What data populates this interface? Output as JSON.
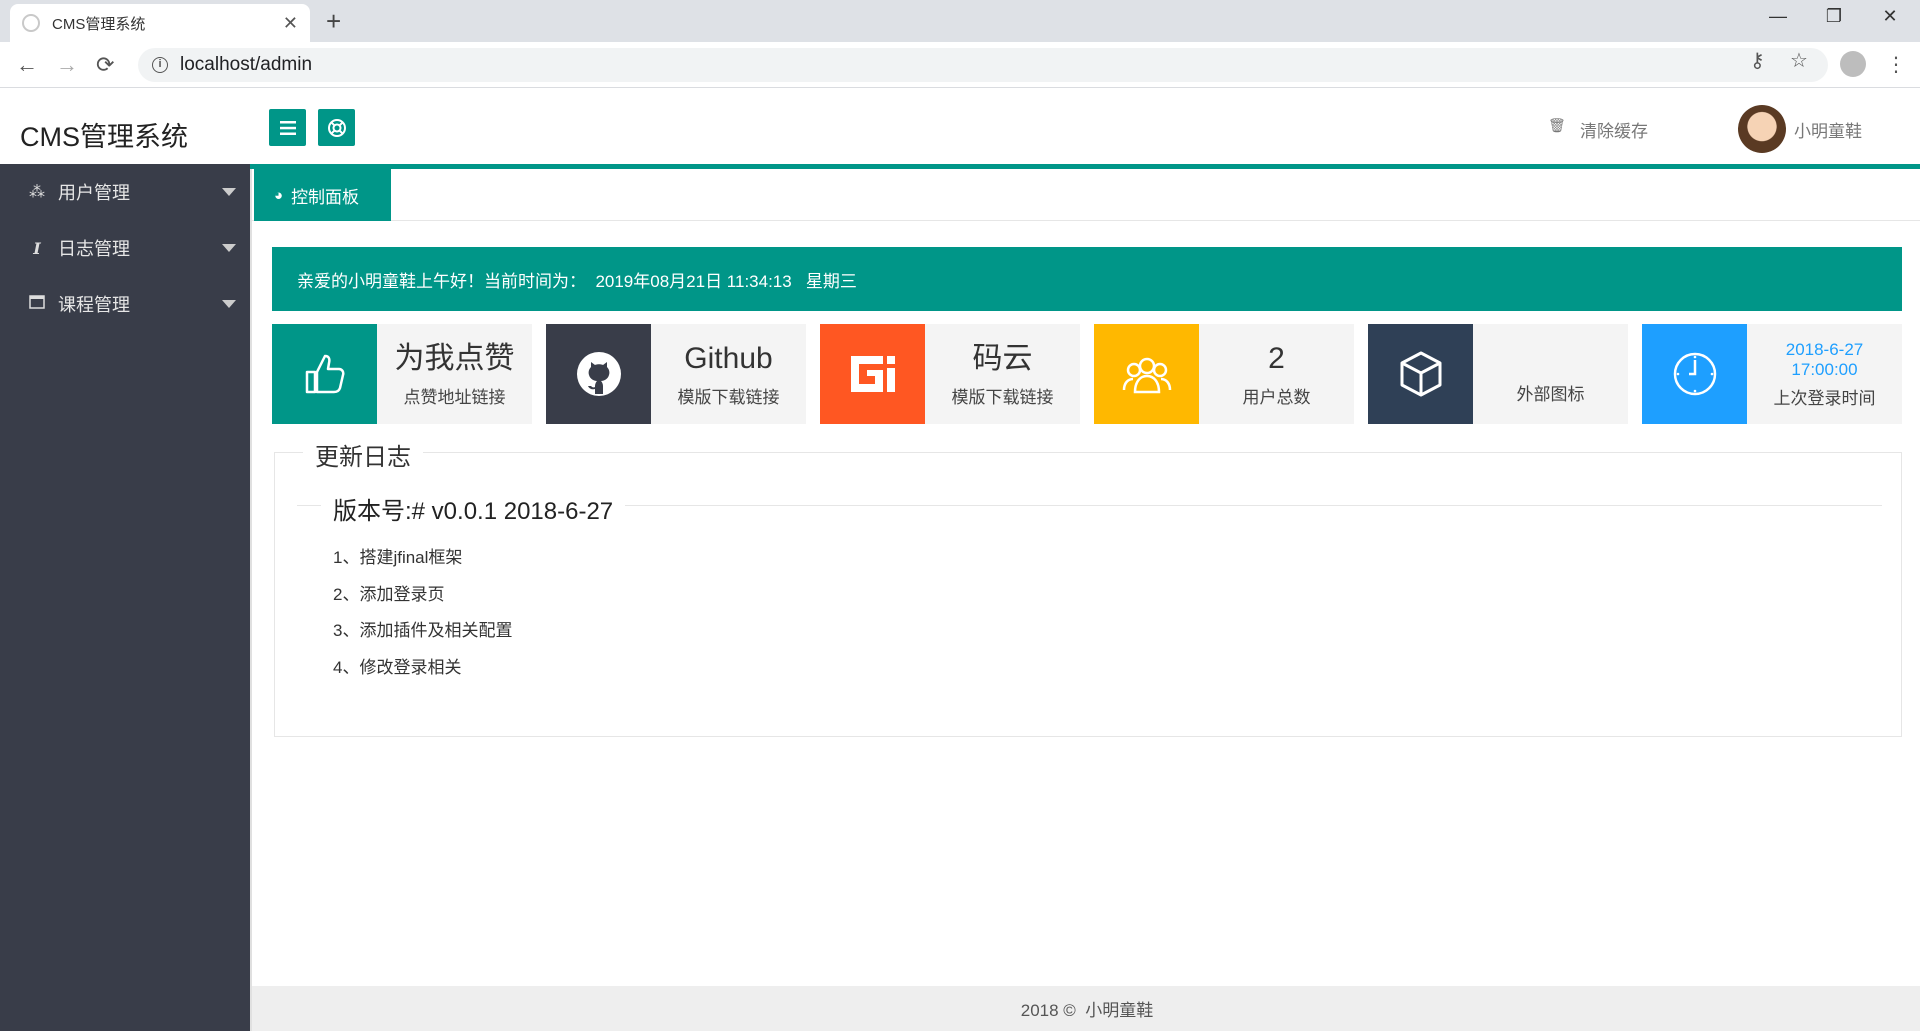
{
  "browser": {
    "tab_title": "CMS管理系统",
    "tab_close": "✕",
    "new_tab": "+",
    "url": "localhost/admin",
    "controls": {
      "minimize": "—",
      "restore": "❐",
      "close": "✕"
    }
  },
  "header": {
    "logo": "CMS管理系统",
    "clear_cache": "清除缓存",
    "username": "小明童鞋"
  },
  "sidebar": {
    "items": [
      {
        "label": "用户管理",
        "icon": "users-icon"
      },
      {
        "label": "日志管理",
        "icon": "italic-icon"
      },
      {
        "label": "课程管理",
        "icon": "calendar-icon"
      }
    ]
  },
  "tabs": {
    "dashboard": "控制面板"
  },
  "welcome": {
    "text": "亲爱的小明童鞋上午好！当前时间为：  2019年08月21日 11:34:13   星期三"
  },
  "cards": [
    {
      "big": "为我点赞",
      "small": "点赞地址链接",
      "icon": "thumbs-up-icon",
      "color": "#009688"
    },
    {
      "big": "Github",
      "small": "模版下载链接",
      "icon": "github-icon",
      "color": "#393d49"
    },
    {
      "big": "码云",
      "small": "模版下载链接",
      "icon": "gitee-icon",
      "color": "#ff5722"
    },
    {
      "big": "2",
      "small": "用户总数",
      "icon": "users-icon",
      "color": "#ffb800"
    },
    {
      "big": "",
      "small": "外部图标",
      "icon": "cube-icon",
      "color": "#2f4056"
    },
    {
      "line1": "2018-6-27",
      "line2": "17:00:00",
      "small": "上次登录时间",
      "icon": "clock-icon",
      "color": "#1e9fff"
    }
  ],
  "changelog": {
    "legend": "更新日志",
    "version": "版本号:# v0.0.1 2018-6-27",
    "items": [
      "1、搭建jfinal框架",
      "2、添加登录页",
      "3、添加插件及相关配置",
      "4、修改登录相关"
    ]
  },
  "footer": {
    "text": "2018 ©  小明童鞋"
  }
}
